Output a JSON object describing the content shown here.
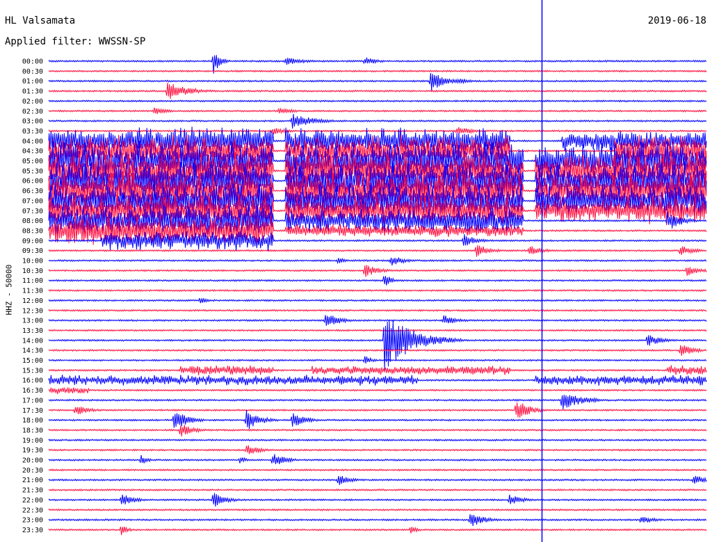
{
  "header": {
    "station": "HL Valsamata",
    "date": "2019-06-18",
    "filter": "Applied filter: WWSSN-SP"
  },
  "channel_label": "HHZ - 50000",
  "colors": {
    "trace_a": "#0000ff",
    "trace_b": "#ff1040",
    "marker": "#0000ff"
  },
  "chart_data": {
    "type": "line",
    "title": "",
    "y_tick_labels": [
      "00:00",
      "00:30",
      "01:00",
      "01:30",
      "02:00",
      "02:30",
      "03:00",
      "03:30",
      "04:00",
      "04:30",
      "05:00",
      "05:30",
      "06:00",
      "06:30",
      "07:00",
      "07:30",
      "08:00",
      "08:30",
      "09:00",
      "09:30",
      "10:00",
      "10:30",
      "11:00",
      "11:30",
      "12:00",
      "12:30",
      "13:00",
      "13:30",
      "14:00",
      "14:30",
      "15:00",
      "15:30",
      "16:00",
      "16:30",
      "17:00",
      "17:30",
      "18:00",
      "18:30",
      "19:00",
      "19:30",
      "20:00",
      "20:30",
      "21:00",
      "21:30",
      "22:00",
      "22:30",
      "23:00",
      "23:30"
    ],
    "row_minutes": 30,
    "colors_alternate": [
      "blue",
      "red"
    ],
    "vertical_marker": {
      "row": "16:30",
      "minute_offset": 22.5
    },
    "events": [
      {
        "row": "00:00",
        "at": 0.25,
        "amp": 18,
        "dur": 0.01
      },
      {
        "row": "00:00",
        "at": 0.36,
        "amp": 6,
        "dur": 0.03
      },
      {
        "row": "00:00",
        "at": 0.48,
        "amp": 6,
        "dur": 0.02
      },
      {
        "row": "01:00",
        "at": 0.58,
        "amp": 16,
        "dur": 0.02
      },
      {
        "row": "01:00",
        "at": 0.62,
        "amp": 5,
        "dur": 0.02
      },
      {
        "row": "01:30",
        "at": 0.18,
        "amp": 14,
        "dur": 0.03
      },
      {
        "row": "02:30",
        "at": 0.16,
        "amp": 6,
        "dur": 0.02
      },
      {
        "row": "02:30",
        "at": 0.35,
        "amp": 6,
        "dur": 0.02
      },
      {
        "row": "03:00",
        "at": 0.37,
        "amp": 12,
        "dur": 0.03
      },
      {
        "row": "03:30",
        "at": 0.62,
        "amp": 8,
        "dur": 0.02
      },
      {
        "row": "03:30",
        "at": 0.34,
        "amp": 6,
        "dur": 0.02
      },
      {
        "row": "04:00",
        "at": 0.02,
        "amp": 8,
        "dur": 0.02
      },
      {
        "row": "04:00",
        "at": 0.2,
        "amp": 14,
        "dur": 0.03
      },
      {
        "row": "08:00",
        "at": 0.94,
        "amp": 16,
        "dur": 0.02
      },
      {
        "row": "09:00",
        "at": 0.63,
        "amp": 10,
        "dur": 0.02
      },
      {
        "row": "09:30",
        "at": 0.65,
        "amp": 10,
        "dur": 0.02
      },
      {
        "row": "09:30",
        "at": 0.73,
        "amp": 8,
        "dur": 0.02
      },
      {
        "row": "09:30",
        "at": 0.96,
        "amp": 8,
        "dur": 0.02
      },
      {
        "row": "10:00",
        "at": 0.44,
        "amp": 6,
        "dur": 0.01
      },
      {
        "row": "10:00",
        "at": 0.52,
        "amp": 8,
        "dur": 0.02
      },
      {
        "row": "10:30",
        "at": 0.48,
        "amp": 10,
        "dur": 0.02
      },
      {
        "row": "10:30",
        "at": 0.97,
        "amp": 8,
        "dur": 0.02
      },
      {
        "row": "11:00",
        "at": 0.51,
        "amp": 12,
        "dur": 0.01
      },
      {
        "row": "12:00",
        "at": 0.23,
        "amp": 6,
        "dur": 0.01
      },
      {
        "row": "13:00",
        "at": 0.42,
        "amp": 12,
        "dur": 0.02
      },
      {
        "row": "13:00",
        "at": 0.6,
        "amp": 8,
        "dur": 0.02
      },
      {
        "row": "14:00",
        "at": 0.51,
        "amp": 45,
        "dur": 0.04
      },
      {
        "row": "14:00",
        "at": 0.91,
        "amp": 10,
        "dur": 0.02
      },
      {
        "row": "14:30",
        "at": 0.96,
        "amp": 10,
        "dur": 0.02
      },
      {
        "row": "15:00",
        "at": 0.48,
        "amp": 8,
        "dur": 0.01
      },
      {
        "row": "17:00",
        "at": 0.78,
        "amp": 14,
        "dur": 0.03
      },
      {
        "row": "17:30",
        "at": 0.71,
        "amp": 16,
        "dur": 0.02
      },
      {
        "row": "17:30",
        "at": 0.04,
        "amp": 8,
        "dur": 0.02
      },
      {
        "row": "18:00",
        "at": 0.19,
        "amp": 16,
        "dur": 0.02
      },
      {
        "row": "18:00",
        "at": 0.3,
        "amp": 16,
        "dur": 0.02
      },
      {
        "row": "18:00",
        "at": 0.37,
        "amp": 12,
        "dur": 0.02
      },
      {
        "row": "18:30",
        "at": 0.2,
        "amp": 10,
        "dur": 0.02
      },
      {
        "row": "19:30",
        "at": 0.3,
        "amp": 8,
        "dur": 0.02
      },
      {
        "row": "20:00",
        "at": 0.34,
        "amp": 10,
        "dur": 0.02
      },
      {
        "row": "20:00",
        "at": 0.14,
        "amp": 8,
        "dur": 0.01
      },
      {
        "row": "20:00",
        "at": 0.29,
        "amp": 6,
        "dur": 0.01
      },
      {
        "row": "21:00",
        "at": 0.44,
        "amp": 8,
        "dur": 0.02
      },
      {
        "row": "21:00",
        "at": 0.98,
        "amp": 8,
        "dur": 0.02
      },
      {
        "row": "22:00",
        "at": 0.11,
        "amp": 10,
        "dur": 0.02
      },
      {
        "row": "22:00",
        "at": 0.25,
        "amp": 12,
        "dur": 0.02
      },
      {
        "row": "22:00",
        "at": 0.7,
        "amp": 8,
        "dur": 0.02
      },
      {
        "row": "23:00",
        "at": 0.64,
        "amp": 12,
        "dur": 0.02
      },
      {
        "row": "23:00",
        "at": 0.9,
        "amp": 6,
        "dur": 0.02
      },
      {
        "row": "23:30",
        "at": 0.11,
        "amp": 8,
        "dur": 0.01
      },
      {
        "row": "23:30",
        "at": 0.55,
        "amp": 6,
        "dur": 0.01
      }
    ],
    "bursts": [
      {
        "row": "04:00",
        "from": 0.0,
        "to": 0.34,
        "amp": 22
      },
      {
        "row": "04:00",
        "from": 0.36,
        "to": 0.7,
        "amp": 22
      },
      {
        "row": "04:00",
        "from": 0.78,
        "to": 0.86,
        "amp": 18
      },
      {
        "row": "04:00",
        "from": 0.86,
        "to": 1.0,
        "amp": 16
      },
      {
        "row": "04:30",
        "from": 0.0,
        "to": 0.34,
        "amp": 24
      },
      {
        "row": "04:30",
        "from": 0.36,
        "to": 0.7,
        "amp": 24
      },
      {
        "row": "04:30",
        "from": 0.86,
        "to": 1.0,
        "amp": 26
      },
      {
        "row": "05:00",
        "from": 0.0,
        "to": 0.34,
        "amp": 30
      },
      {
        "row": "05:00",
        "from": 0.36,
        "to": 0.72,
        "amp": 30
      },
      {
        "row": "05:00",
        "from": 0.74,
        "to": 0.86,
        "amp": 26
      },
      {
        "row": "05:00",
        "from": 0.86,
        "to": 1.0,
        "amp": 30
      },
      {
        "row": "05:30",
        "from": 0.0,
        "to": 0.34,
        "amp": 30
      },
      {
        "row": "05:30",
        "from": 0.36,
        "to": 0.72,
        "amp": 30
      },
      {
        "row": "05:30",
        "from": 0.74,
        "to": 0.86,
        "amp": 26
      },
      {
        "row": "05:30",
        "from": 0.86,
        "to": 1.0,
        "amp": 30
      },
      {
        "row": "06:00",
        "from": 0.0,
        "to": 0.34,
        "amp": 30
      },
      {
        "row": "06:00",
        "from": 0.36,
        "to": 0.72,
        "amp": 30
      },
      {
        "row": "06:00",
        "from": 0.74,
        "to": 0.86,
        "amp": 26
      },
      {
        "row": "06:00",
        "from": 0.86,
        "to": 1.0,
        "amp": 30
      },
      {
        "row": "06:30",
        "from": 0.0,
        "to": 0.34,
        "amp": 30
      },
      {
        "row": "06:30",
        "from": 0.36,
        "to": 0.72,
        "amp": 30
      },
      {
        "row": "06:30",
        "from": 0.74,
        "to": 0.86,
        "amp": 26
      },
      {
        "row": "06:30",
        "from": 0.86,
        "to": 1.0,
        "amp": 30
      },
      {
        "row": "07:00",
        "from": 0.0,
        "to": 0.34,
        "amp": 28
      },
      {
        "row": "07:00",
        "from": 0.36,
        "to": 0.72,
        "amp": 28
      },
      {
        "row": "07:00",
        "from": 0.74,
        "to": 0.86,
        "amp": 24
      },
      {
        "row": "07:00",
        "from": 0.86,
        "to": 1.0,
        "amp": 26
      },
      {
        "row": "07:30",
        "from": 0.0,
        "to": 0.34,
        "amp": 26
      },
      {
        "row": "07:30",
        "from": 0.36,
        "to": 0.72,
        "amp": 24
      },
      {
        "row": "07:30",
        "from": 0.74,
        "to": 0.86,
        "amp": 18
      },
      {
        "row": "07:30",
        "from": 0.86,
        "to": 1.0,
        "amp": 22
      },
      {
        "row": "08:00",
        "from": 0.0,
        "to": 0.34,
        "amp": 26
      },
      {
        "row": "08:00",
        "from": 0.36,
        "to": 0.72,
        "amp": 20
      },
      {
        "row": "08:30",
        "from": 0.0,
        "to": 0.34,
        "amp": 24
      },
      {
        "row": "08:30",
        "from": 0.36,
        "to": 0.72,
        "amp": 10
      },
      {
        "row": "09:00",
        "from": 0.08,
        "to": 0.34,
        "amp": 16
      },
      {
        "row": "15:30",
        "from": 0.2,
        "to": 0.34,
        "amp": 8
      },
      {
        "row": "15:30",
        "from": 0.4,
        "to": 0.7,
        "amp": 7
      },
      {
        "row": "15:30",
        "from": 0.94,
        "to": 1.0,
        "amp": 8
      },
      {
        "row": "16:00",
        "from": 0.0,
        "to": 0.56,
        "amp": 8
      },
      {
        "row": "16:00",
        "from": 0.74,
        "to": 1.0,
        "amp": 8
      },
      {
        "row": "16:30",
        "from": 0.0,
        "to": 0.06,
        "amp": 6
      }
    ]
  }
}
